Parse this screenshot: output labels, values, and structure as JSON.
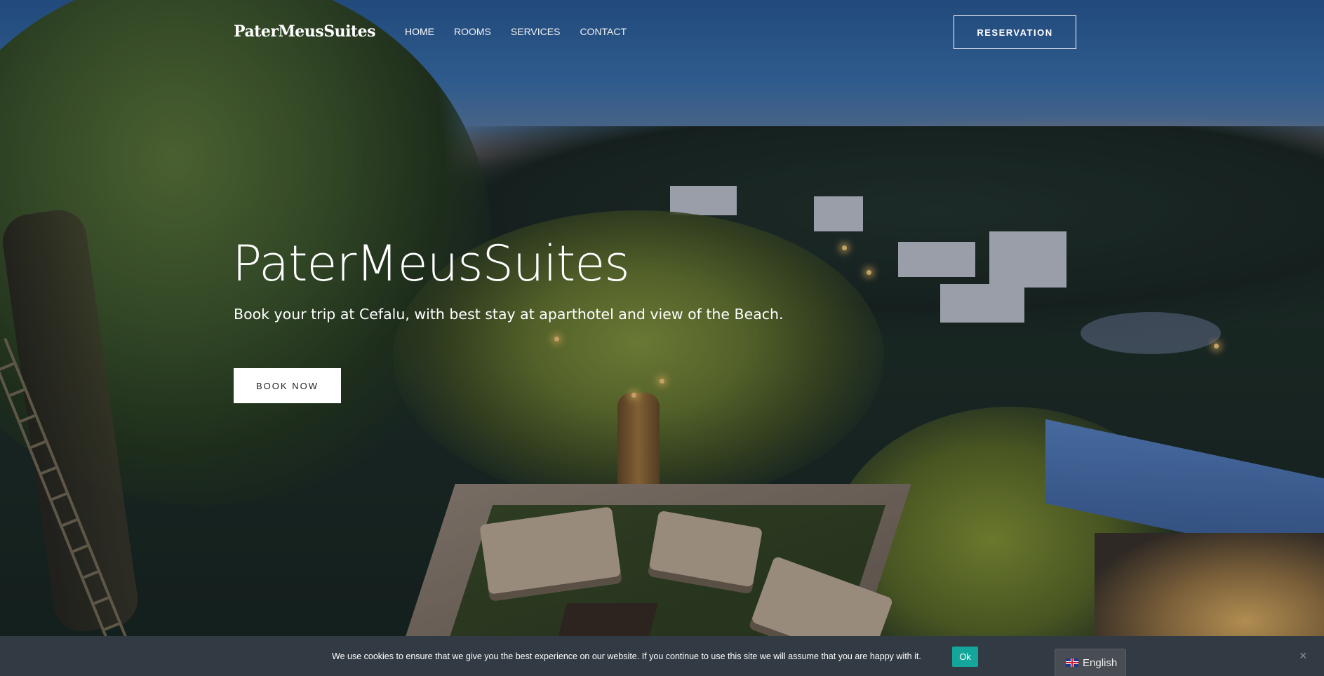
{
  "header": {
    "logo": "PaterMeusSuites",
    "nav": [
      {
        "label": "HOME"
      },
      {
        "label": "ROOMS"
      },
      {
        "label": "SERVICES"
      },
      {
        "label": "CONTACT"
      }
    ],
    "reservation_label": "RESERVATION"
  },
  "hero": {
    "title": "PaterMeusSuites",
    "subtitle": "Book your trip at Cefalu, with best stay at aparthotel and view of the Beach.",
    "cta_label": "BOOK NOW"
  },
  "cookie": {
    "message": "We use cookies to ensure that we give you the best experience on our website. If you continue to use this site we will assume that you are happy with it.",
    "ok_label": "Ok",
    "close_glyph": "×"
  },
  "language": {
    "selected": "English",
    "flag_icon": "uk-flag-icon"
  },
  "colors": {
    "cookie_bar_bg": "#323b44",
    "ok_button": "#14a69a"
  }
}
